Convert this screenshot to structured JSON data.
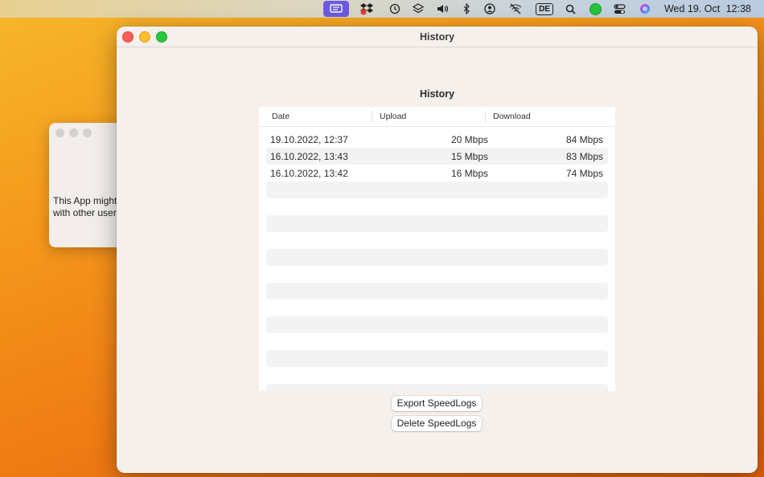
{
  "menubar": {
    "keyboard_layout": "DE",
    "clock_day": "Wed 19. Oct",
    "clock_time": "12:38",
    "icons": [
      "speedlogs-app-icon",
      "dropbox-icon",
      "time-machine-icon",
      "layers-icon",
      "volume-icon",
      "bluetooth-icon",
      "user-icon",
      "wifi-off-icon",
      "keyboard-layout-icon",
      "search-icon",
      "status-dot-icon",
      "control-center-icon",
      "siri-icon"
    ],
    "status_dot_color": "#27c13a"
  },
  "background_dialog": {
    "line1": "This App might",
    "line2": "with other user"
  },
  "window": {
    "title": "History",
    "section_title": "History",
    "columns": {
      "date": "Date",
      "upload": "Upload",
      "download": "Download"
    },
    "rows": [
      {
        "date": "19.10.2022, 12:37",
        "upload": "20 Mbps",
        "download": "84 Mbps"
      },
      {
        "date": "16.10.2022, 13:43",
        "upload": "15 Mbps",
        "download": "83 Mbps"
      },
      {
        "date": "16.10.2022, 13:42",
        "upload": "16 Mbps",
        "download": "74 Mbps"
      }
    ],
    "export_button": "Export SpeedLogs",
    "delete_button": "Delete SpeedLogs"
  },
  "colors": {
    "accent": "#6b5ae0",
    "close": "#fe5f57",
    "minimize": "#febc2e",
    "zoom": "#28c840"
  }
}
